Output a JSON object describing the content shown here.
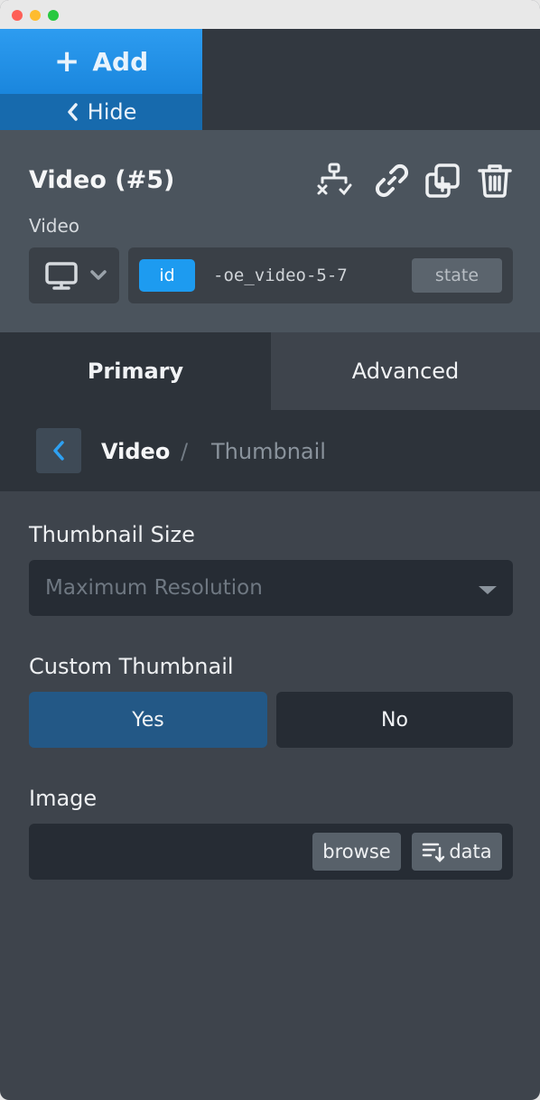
{
  "toolbar": {
    "add_label": "Add",
    "hide_label": "Hide"
  },
  "element": {
    "title": "Video (#5)",
    "type_label": "Video",
    "id_badge": "id",
    "id_value": "-oe_video-5-7",
    "state_label": "state",
    "actions": [
      "structure-icon",
      "link-icon",
      "duplicate-icon",
      "trash-icon"
    ],
    "device": "desktop-icon"
  },
  "tabs": {
    "primary": "Primary",
    "advanced": "Advanced",
    "active": "Primary"
  },
  "breadcrumb": {
    "current": "Video",
    "separator": "/",
    "next": "Thumbnail"
  },
  "fields": {
    "thumbnail_size": {
      "label": "Thumbnail Size",
      "value": "Maximum Resolution"
    },
    "custom_thumbnail": {
      "label": "Custom Thumbnail",
      "options": [
        "Yes",
        "No"
      ],
      "selected": "Yes"
    },
    "image": {
      "label": "Image",
      "value": "",
      "browse_label": "browse",
      "data_label": "data"
    }
  },
  "colors": {
    "accent": "#1d9bf0",
    "selected_toggle": "#235886",
    "panel": "#3e444c"
  }
}
